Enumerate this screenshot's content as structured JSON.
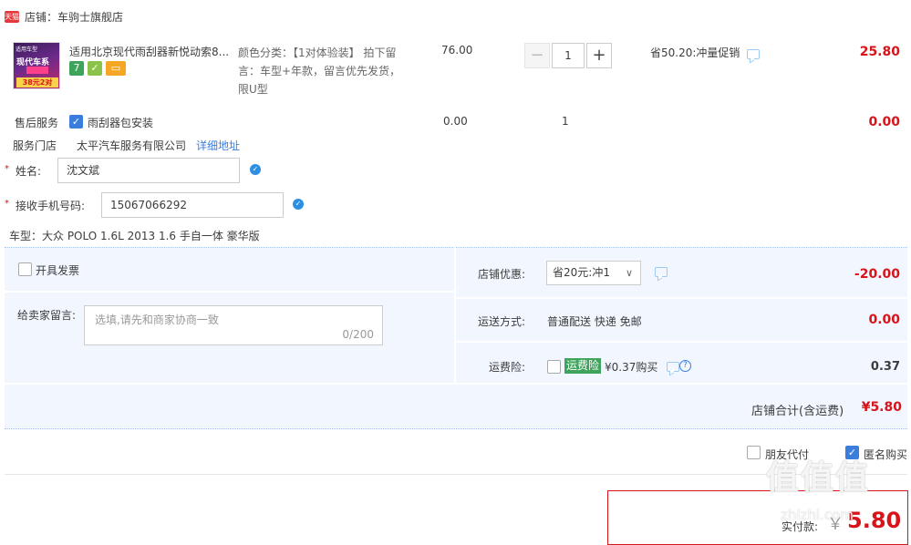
{
  "shop": {
    "badge": "天猫",
    "name": "店铺：车驹士旗舰店"
  },
  "item": {
    "thumb": {
      "line1": "适用车型",
      "line2": "现代车系",
      "line3": "38元2对"
    },
    "title": "适用北京现代雨刮器新悦动索8...",
    "icons": [
      {
        "name": "seven-day-return-icon",
        "glyph": "7",
        "color": "#3ea45b"
      },
      {
        "name": "guarantee-icon",
        "glyph": "✓",
        "color": "#8bc34a"
      },
      {
        "name": "card-icon",
        "glyph": "▭",
        "color": "#f5a623"
      }
    ],
    "sku": "颜色分类：【1对体验装】 拍下留言：车型+年款，留言优先发货，限U型",
    "price": "76.00",
    "quantity": "1",
    "promo": "省50.20:冲量促销",
    "subtotal": "25.80"
  },
  "service": {
    "label": "售后服务",
    "option": "雨刮器包安装",
    "price": "0.00",
    "quantity": "1",
    "subtotal": "0.00",
    "store_label": "服务门店",
    "store_name": "太平汽车服务有限公司",
    "store_link": "详细地址"
  },
  "form": {
    "name_label": "姓名:",
    "name_value": "沈文斌",
    "phone_label": "接收手机号码:",
    "phone_value": "15067066292",
    "car_model": "车型：大众 POLO 1.6L 2013 1.6 手自一体 豪华版"
  },
  "order": {
    "invoice_label": "开具发票",
    "shop_discount_label": "店铺优惠:",
    "shop_discount_select": "省20元:冲1",
    "shop_discount_value": "-20.00",
    "message_label": "给卖家留言:",
    "message_placeholder": "选填,请先和商家协商一致",
    "message_counter": "0/200",
    "shipping_label": "运送方式:",
    "shipping_value": "普通配送 快递 免邮",
    "shipping_price": "0.00",
    "insurance_label": "运费险:",
    "insurance_tag": "运费险",
    "insurance_price_text": "¥0.37购买",
    "insurance_value": "0.37",
    "shop_total_label": "店铺合计(含运费)",
    "shop_total_value": "¥5.80"
  },
  "footer": {
    "friend_pay_label": "朋友代付",
    "anonymous_label": "匿名购买",
    "actual_label": "实付款:",
    "currency": "￥",
    "actual_value": "5.80"
  },
  "watermark": {
    "main": "值值值",
    "sub": "zhizhi.com"
  },
  "colors": {
    "accent_red": "#d7141a",
    "link_blue": "#3b7ddd",
    "panel_bg": "#f2f7ff",
    "insurance_green": "#3ea45b"
  }
}
